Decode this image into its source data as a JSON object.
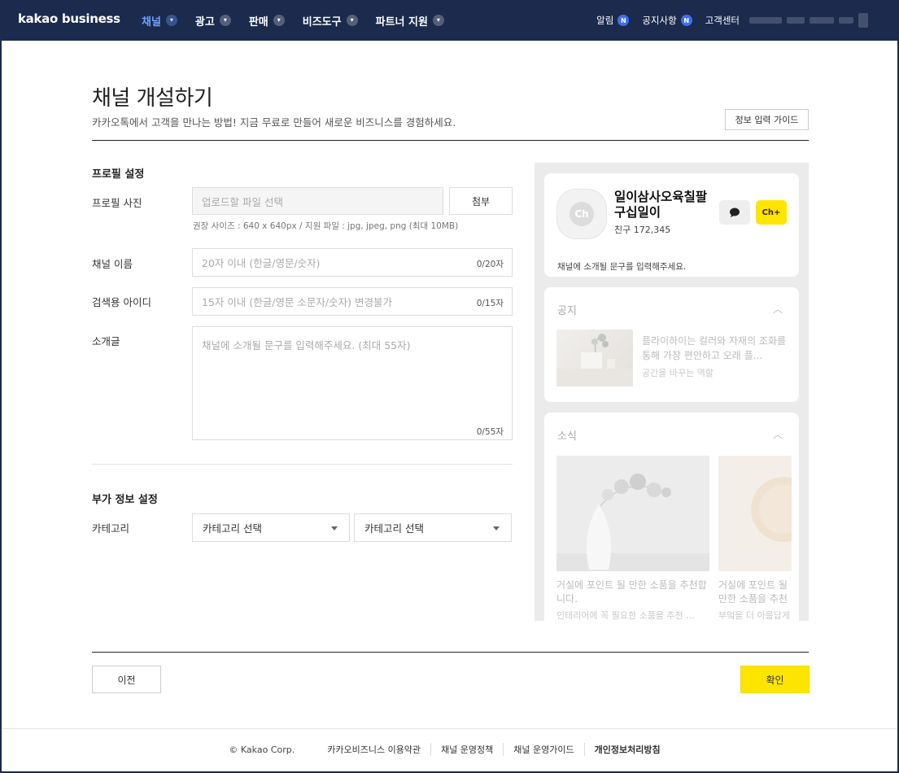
{
  "nav": {
    "logo": "kakao business",
    "menu": [
      {
        "label": "채널",
        "active": true
      },
      {
        "label": "광고",
        "active": false
      },
      {
        "label": "판매",
        "active": false
      },
      {
        "label": "비즈도구",
        "active": false
      },
      {
        "label": "파트너 지원",
        "active": false
      }
    ],
    "right": {
      "alerts": "알림",
      "notices": "공지사항",
      "support": "고객센터",
      "badge": "N"
    }
  },
  "header": {
    "title": "채널 개설하기",
    "subtitle": "카카오톡에서 고객을 만나는 방법! 지금 무료로 만들어 새로운 비즈니스를 경험하세요.",
    "guide_button": "정보 입력 가이드"
  },
  "profile": {
    "section_title": "프로필 설정",
    "photo_label": "프로필 사진",
    "photo_placeholder": "업로드할 파일 선택",
    "attach_button": "첨부",
    "photo_hint": "권장 사이즈 : 640 x 640px / 지원 파일 : jpg, jpeg, png (최대 10MB)",
    "name_label": "채널 이름",
    "name_placeholder": "20자 이내 (한글/영문/숫자)",
    "name_counter": "0/20자",
    "id_label": "검색용 아이디",
    "id_placeholder": "15자 이내 (한글/영문 소문자/숫자) 변경불가",
    "id_counter": "0/15자",
    "intro_label": "소개글",
    "intro_placeholder": "채널에 소개될 문구를 입력해주세요. (최대 55자)",
    "intro_counter": "0/55자"
  },
  "extra": {
    "section_title": "부가 정보 설정",
    "category_label": "카테고리",
    "category_select_1": "카테고리 선택",
    "category_select_2": "카테고리 선택"
  },
  "preview": {
    "avatar_text": "Ch",
    "channel_name": "일이삼사오육칠팔구십일이",
    "friends": "친구 172,345",
    "add_label": "Ch+",
    "description": "채널에 소개될 문구를 입력해주세요.",
    "notice_title": "공지",
    "notice_text": "플라이하이는 컬러와 자재의 조화를 통해 가장 편안하고 오래 플...",
    "notice_sub": "공간을 바꾸는 역할",
    "news_title": "소식",
    "news_1_caption": "거실에 포인트 될 만한 소품을 추천합니다.",
    "news_1_sub": "인테리어에 꼭 필요한 소품을 추천 ...",
    "news_2_caption": "거실에 포인트 될 만한 소품을 추천합니다.",
    "news_2_sub": "부엌을 더 아름답게"
  },
  "actions": {
    "prev": "이전",
    "confirm": "확인"
  },
  "footer": {
    "copyright": "© Kakao Corp.",
    "links": [
      "카카오비즈니스 이용약관",
      "채널 운영정책",
      "채널 운영가이드",
      "개인정보처리방침"
    ]
  },
  "colors": {
    "nav_bg": "#1b2a4d",
    "accent": "#6fa2ff",
    "kakao_yellow": "#fee500",
    "badge_blue": "#3c6ff0"
  }
}
